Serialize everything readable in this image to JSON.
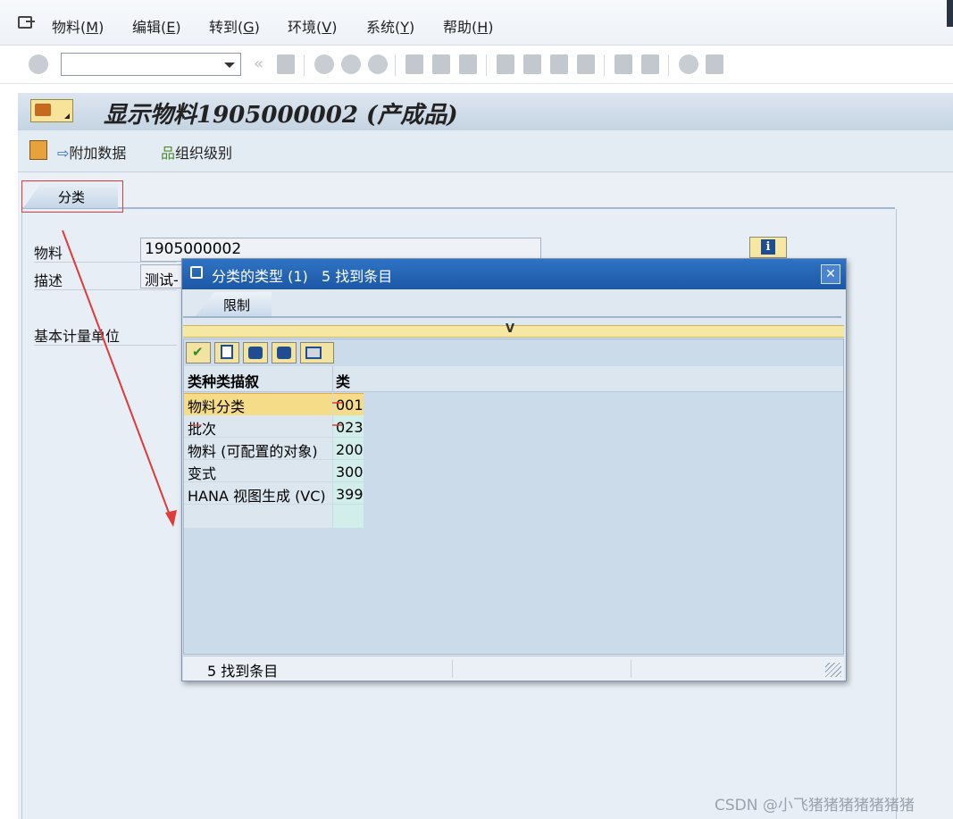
{
  "menu": {
    "items": [
      {
        "label": "物料(",
        "key": "M",
        "tail": ")"
      },
      {
        "label": "编辑(",
        "key": "E",
        "tail": ")"
      },
      {
        "label": "转到(",
        "key": "G",
        "tail": ")"
      },
      {
        "label": "环境(",
        "key": "V",
        "tail": ")"
      },
      {
        "label": "系统(",
        "key": "Y",
        "tail": ")"
      },
      {
        "label": "帮助(",
        "key": "H",
        "tail": ")"
      }
    ]
  },
  "toolbar": {
    "command_value": ""
  },
  "title": {
    "text": "显示物料1905000002 (产成品)"
  },
  "app_toolbar": {
    "additional_data": "附加数据",
    "org_levels": "组织级别"
  },
  "tabs": {
    "classification": "分类"
  },
  "form": {
    "material_label": "物料",
    "material_value": "1905000002",
    "desc_label": "描述",
    "desc_value": "测试-",
    "base_uom_label": "基本计量单位"
  },
  "dialog": {
    "title": "分类的类型 (1)",
    "title_count": "5 找到条目",
    "close_glyph": "✕",
    "tab_restrict": "限制",
    "yellowbar_marker": "V",
    "col_desc_header": "类种类描叙",
    "col_class_header": "类",
    "rows": [
      {
        "desc": "物料分类",
        "code": "001"
      },
      {
        "desc": "批次",
        "code": "023"
      },
      {
        "desc": "物料 (可配置的对象)",
        "code": "200"
      },
      {
        "desc": "变式",
        "code": "300"
      },
      {
        "desc": "HANA 视图生成 (VC)",
        "code": "399"
      }
    ],
    "status": "5 找到条目"
  },
  "info_glyph": "i",
  "watermark": "CSDN @小飞猪猪猪猪猪猪猪",
  "colors": {
    "dialog_title": "#1c58a6",
    "selection": "#f5dc88",
    "annotation": "#e03a3a"
  }
}
